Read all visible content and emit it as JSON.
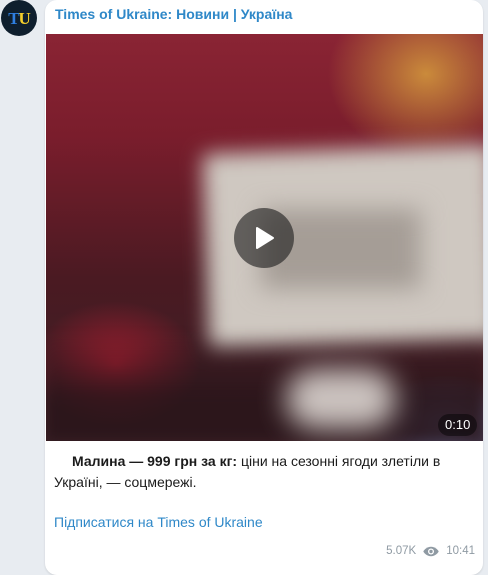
{
  "channel": {
    "name": "Times of Ukraine: Новини | Україна",
    "avatar_letters": [
      "T",
      "U"
    ],
    "avatar_colors": {
      "background": "#0f1f2e",
      "letter_t": "#2f7fe0",
      "letter_u": "#f5cf2b"
    }
  },
  "post": {
    "video": {
      "duration": "0:10",
      "play_icon": "play-icon"
    },
    "caption": {
      "bold": "Малина — 999 грн за кг:",
      "rest": " ціни на сезонні ягоди злетіли в Україні, — соцмережі."
    },
    "subscribe_link": "Підписатися на Times of Ukraine",
    "views": "5.07K",
    "views_icon": "eye-icon",
    "time": "10:41"
  },
  "colors": {
    "link": "#2f88c8",
    "bubble": "#ffffff",
    "page_background": "#e8ecf1",
    "meta_text": "#8f9aa3"
  }
}
